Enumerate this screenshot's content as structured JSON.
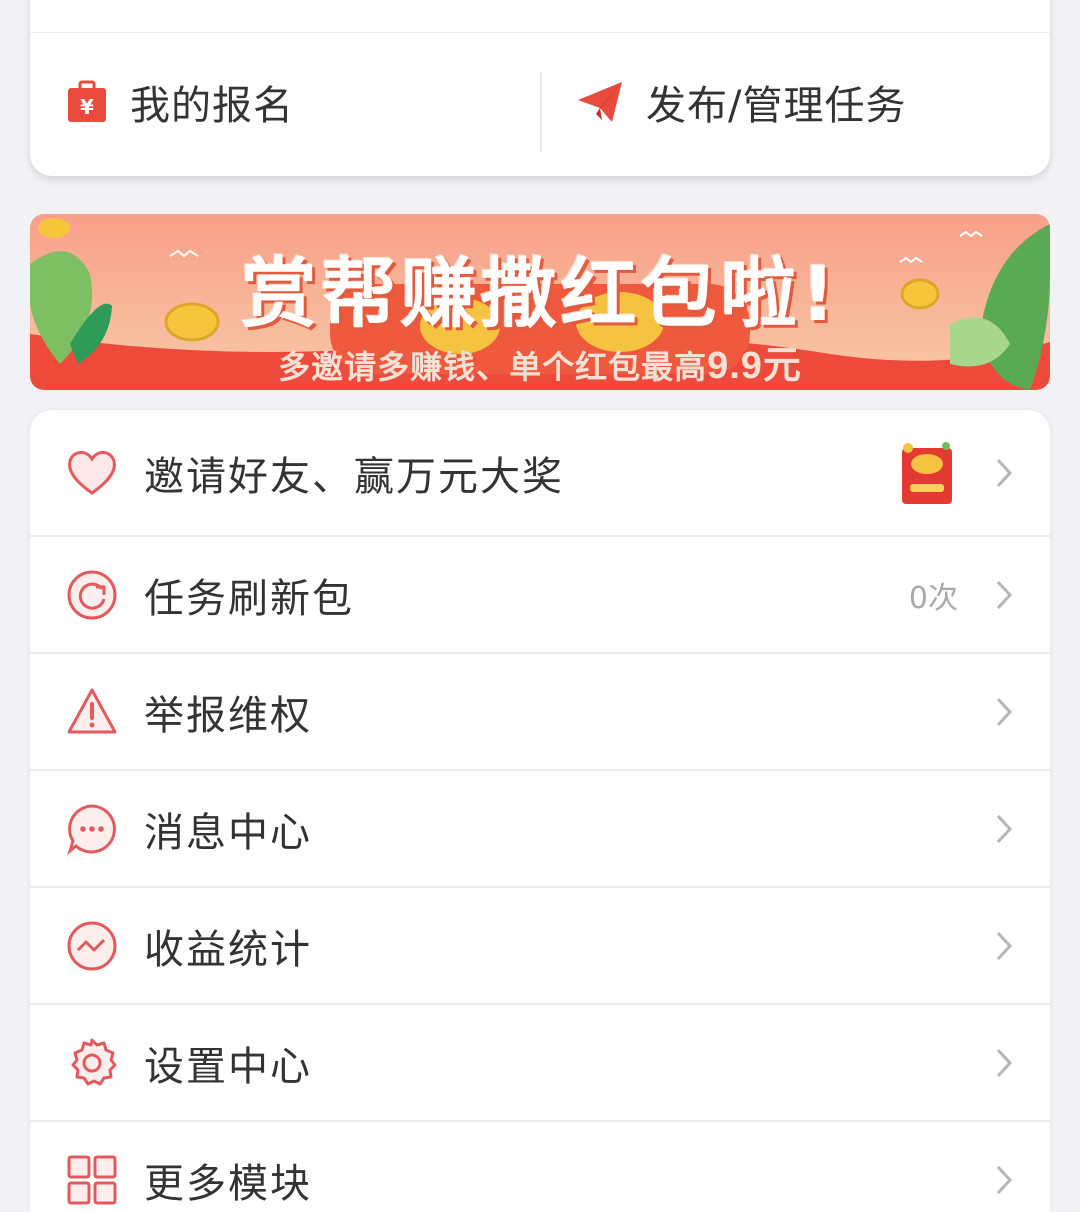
{
  "quick_actions": {
    "my_signup": {
      "label": "我的报名",
      "icon": "wallet-bag-icon"
    },
    "publish": {
      "label": "发布/管理任务",
      "icon": "paper-plane-icon"
    }
  },
  "banner": {
    "title": "赏帮赚撒红包啦!",
    "subtitle_prefix": "多邀请多赚钱、单个红包最高",
    "subtitle_amount": "9.9元"
  },
  "menu": {
    "items": [
      {
        "label": "邀请好友、赢万元大奖",
        "icon": "heart-icon",
        "value": "",
        "thumb": "red-envelope-thumbnail"
      },
      {
        "label": "任务刷新包",
        "icon": "refresh-icon",
        "value": "0次"
      },
      {
        "label": "举报维权",
        "icon": "warning-icon",
        "value": ""
      },
      {
        "label": "消息中心",
        "icon": "chat-bubble-icon",
        "value": ""
      },
      {
        "label": "收益统计",
        "icon": "trend-icon",
        "value": ""
      },
      {
        "label": "设置中心",
        "icon": "gear-icon",
        "value": ""
      },
      {
        "label": "更多模块",
        "icon": "grid-icon",
        "value": ""
      }
    ]
  },
  "colors": {
    "accent": "#e8433a",
    "icon_stroke": "#e25a5d",
    "text": "#333333",
    "muted": "#a9a9a9",
    "background": "#f2f2f6"
  }
}
